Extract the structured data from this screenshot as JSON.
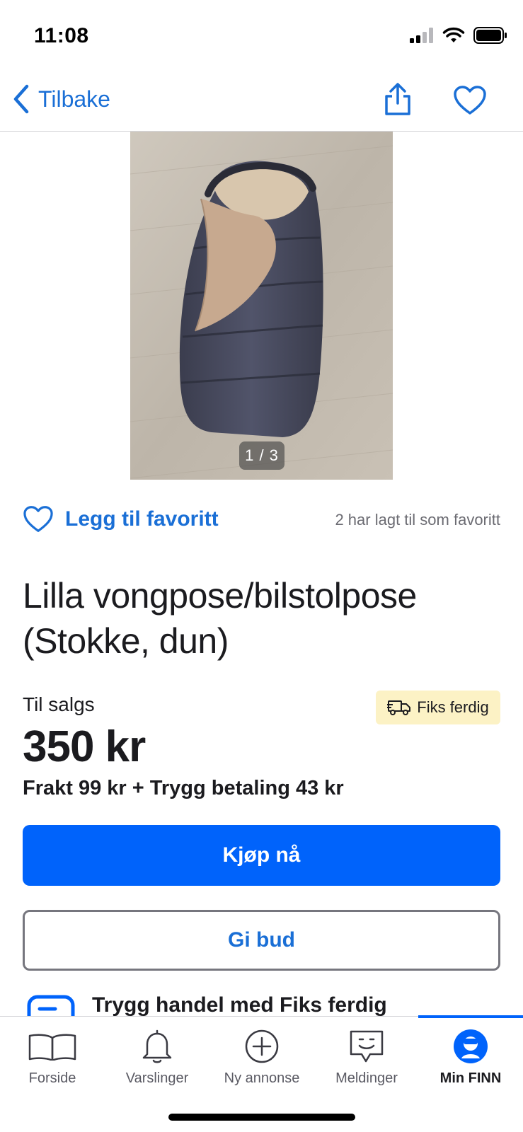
{
  "status_bar": {
    "time": "11:08"
  },
  "nav": {
    "back_label": "Tilbake"
  },
  "gallery": {
    "counter": "1 / 3"
  },
  "favorite": {
    "action_label": "Legg til favoritt",
    "count_text": "2 har lagt til som favoritt"
  },
  "listing": {
    "title": "Lilla vongpose/bilstolpose (Stokke, dun)",
    "sale_label": "Til salgs",
    "badge_label": "Fiks ferdig",
    "price": "350 kr",
    "shipping": "Frakt 99 kr + Trygg betaling 43 kr"
  },
  "actions": {
    "buy_label": "Kjøp nå",
    "bid_label": "Gi bud"
  },
  "safe_trade": {
    "title": "Trygg handel med Fiks ferdig"
  },
  "tabs": [
    {
      "label": "Forside",
      "icon": "book-icon",
      "active": false
    },
    {
      "label": "Varslinger",
      "icon": "bell-icon",
      "active": false
    },
    {
      "label": "Ny annonse",
      "icon": "plus-circle-icon",
      "active": false
    },
    {
      "label": "Meldinger",
      "icon": "chat-icon",
      "active": false
    },
    {
      "label": "Min FINN",
      "icon": "profile-icon",
      "active": true
    }
  ],
  "colors": {
    "accent": "#0063fb",
    "link": "#1a6fd6",
    "badge_bg": "#fcf2c5"
  }
}
